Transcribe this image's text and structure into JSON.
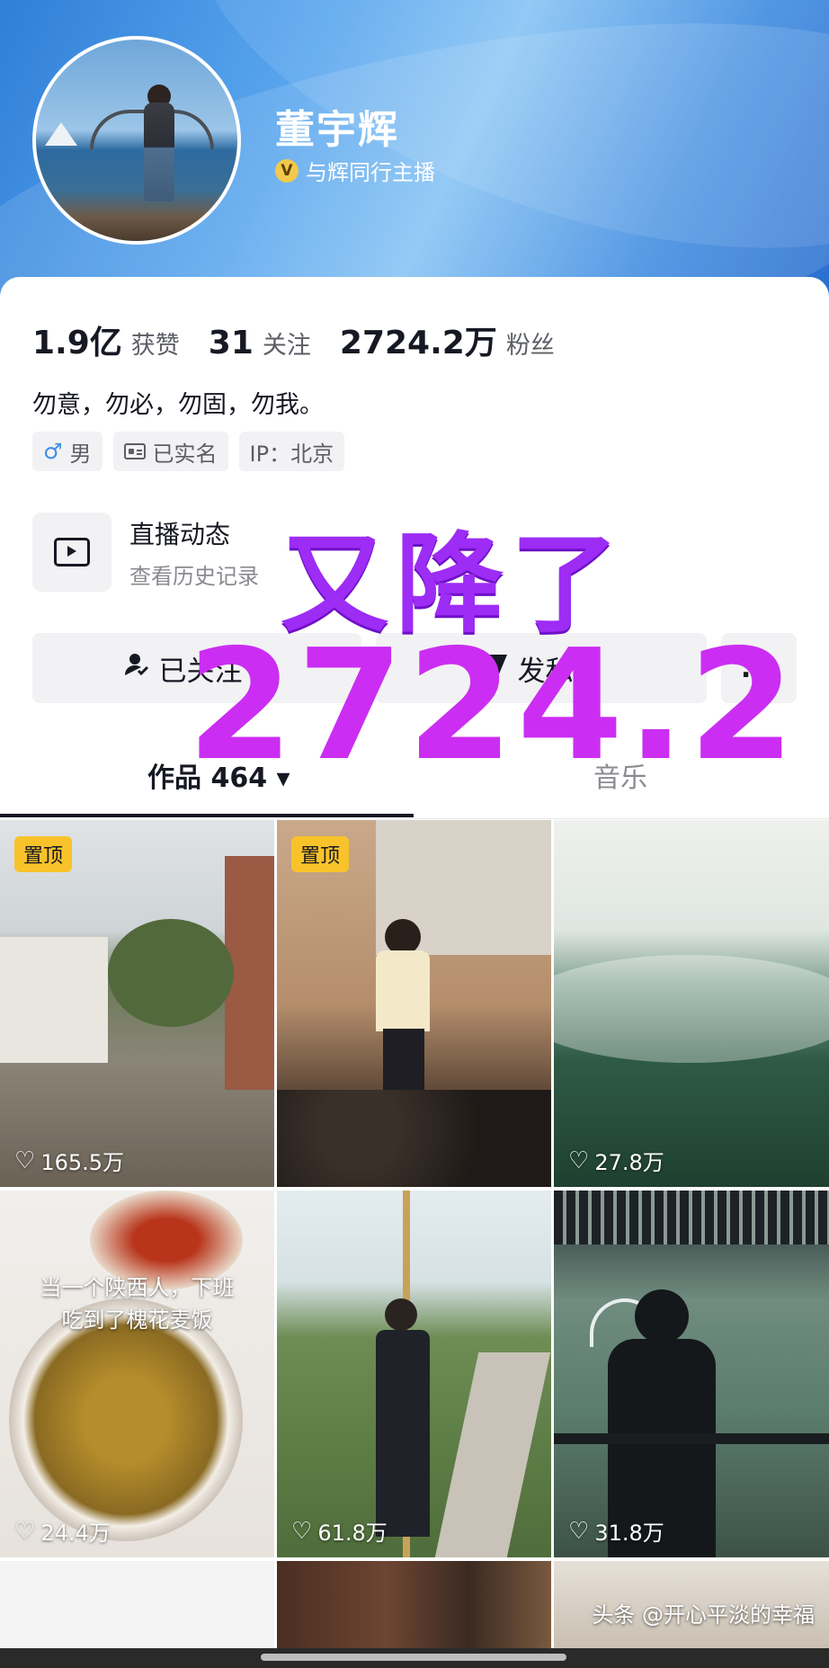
{
  "profile": {
    "name": "董宇辉",
    "verify_badge": "V",
    "verify_text": "与辉同行主播",
    "stats": [
      {
        "value": "1.9亿",
        "label": "获赞"
      },
      {
        "value": "31",
        "label": "关注"
      },
      {
        "value": "2724.2万",
        "label": "粉丝"
      }
    ],
    "bio": "勿意，勿必，勿固，勿我。",
    "tags": [
      {
        "icon": "male-icon",
        "glyph": "♂",
        "text": "男"
      },
      {
        "icon": "id-card-icon",
        "text": "已实名"
      },
      {
        "icon": "",
        "text": "IP：北京"
      }
    ]
  },
  "live": {
    "title": "直播动态",
    "subtitle": "查看历史记录"
  },
  "actions": {
    "follow_label": "已关注",
    "message_label": "发私信",
    "more_label": "..."
  },
  "tabs": {
    "works": "作品 464",
    "music": "音乐"
  },
  "videos": [
    {
      "pinned": true,
      "likes": "165.5万",
      "caption": ""
    },
    {
      "pinned": true,
      "likes": "",
      "caption": ""
    },
    {
      "pinned": false,
      "likes": "27.8万",
      "caption": ""
    },
    {
      "pinned": false,
      "likes": "24.4万",
      "caption": "当一个陕西人，下班\n吃到了槐花麦饭"
    },
    {
      "pinned": false,
      "likes": "61.8万",
      "caption": ""
    },
    {
      "pinned": false,
      "likes": "31.8万",
      "caption": ""
    }
  ],
  "pin_label": "置顶",
  "overlay": {
    "line1": "又降了",
    "line2": "2724.2"
  },
  "watermark": "头条 @开心平淡的幸福",
  "colors": {
    "header_blue": "#3f8be0",
    "overlay_purple": "#9d2cf5",
    "overlay_magenta": "#cb2ef2",
    "pin_yellow": "#f8c32a"
  }
}
